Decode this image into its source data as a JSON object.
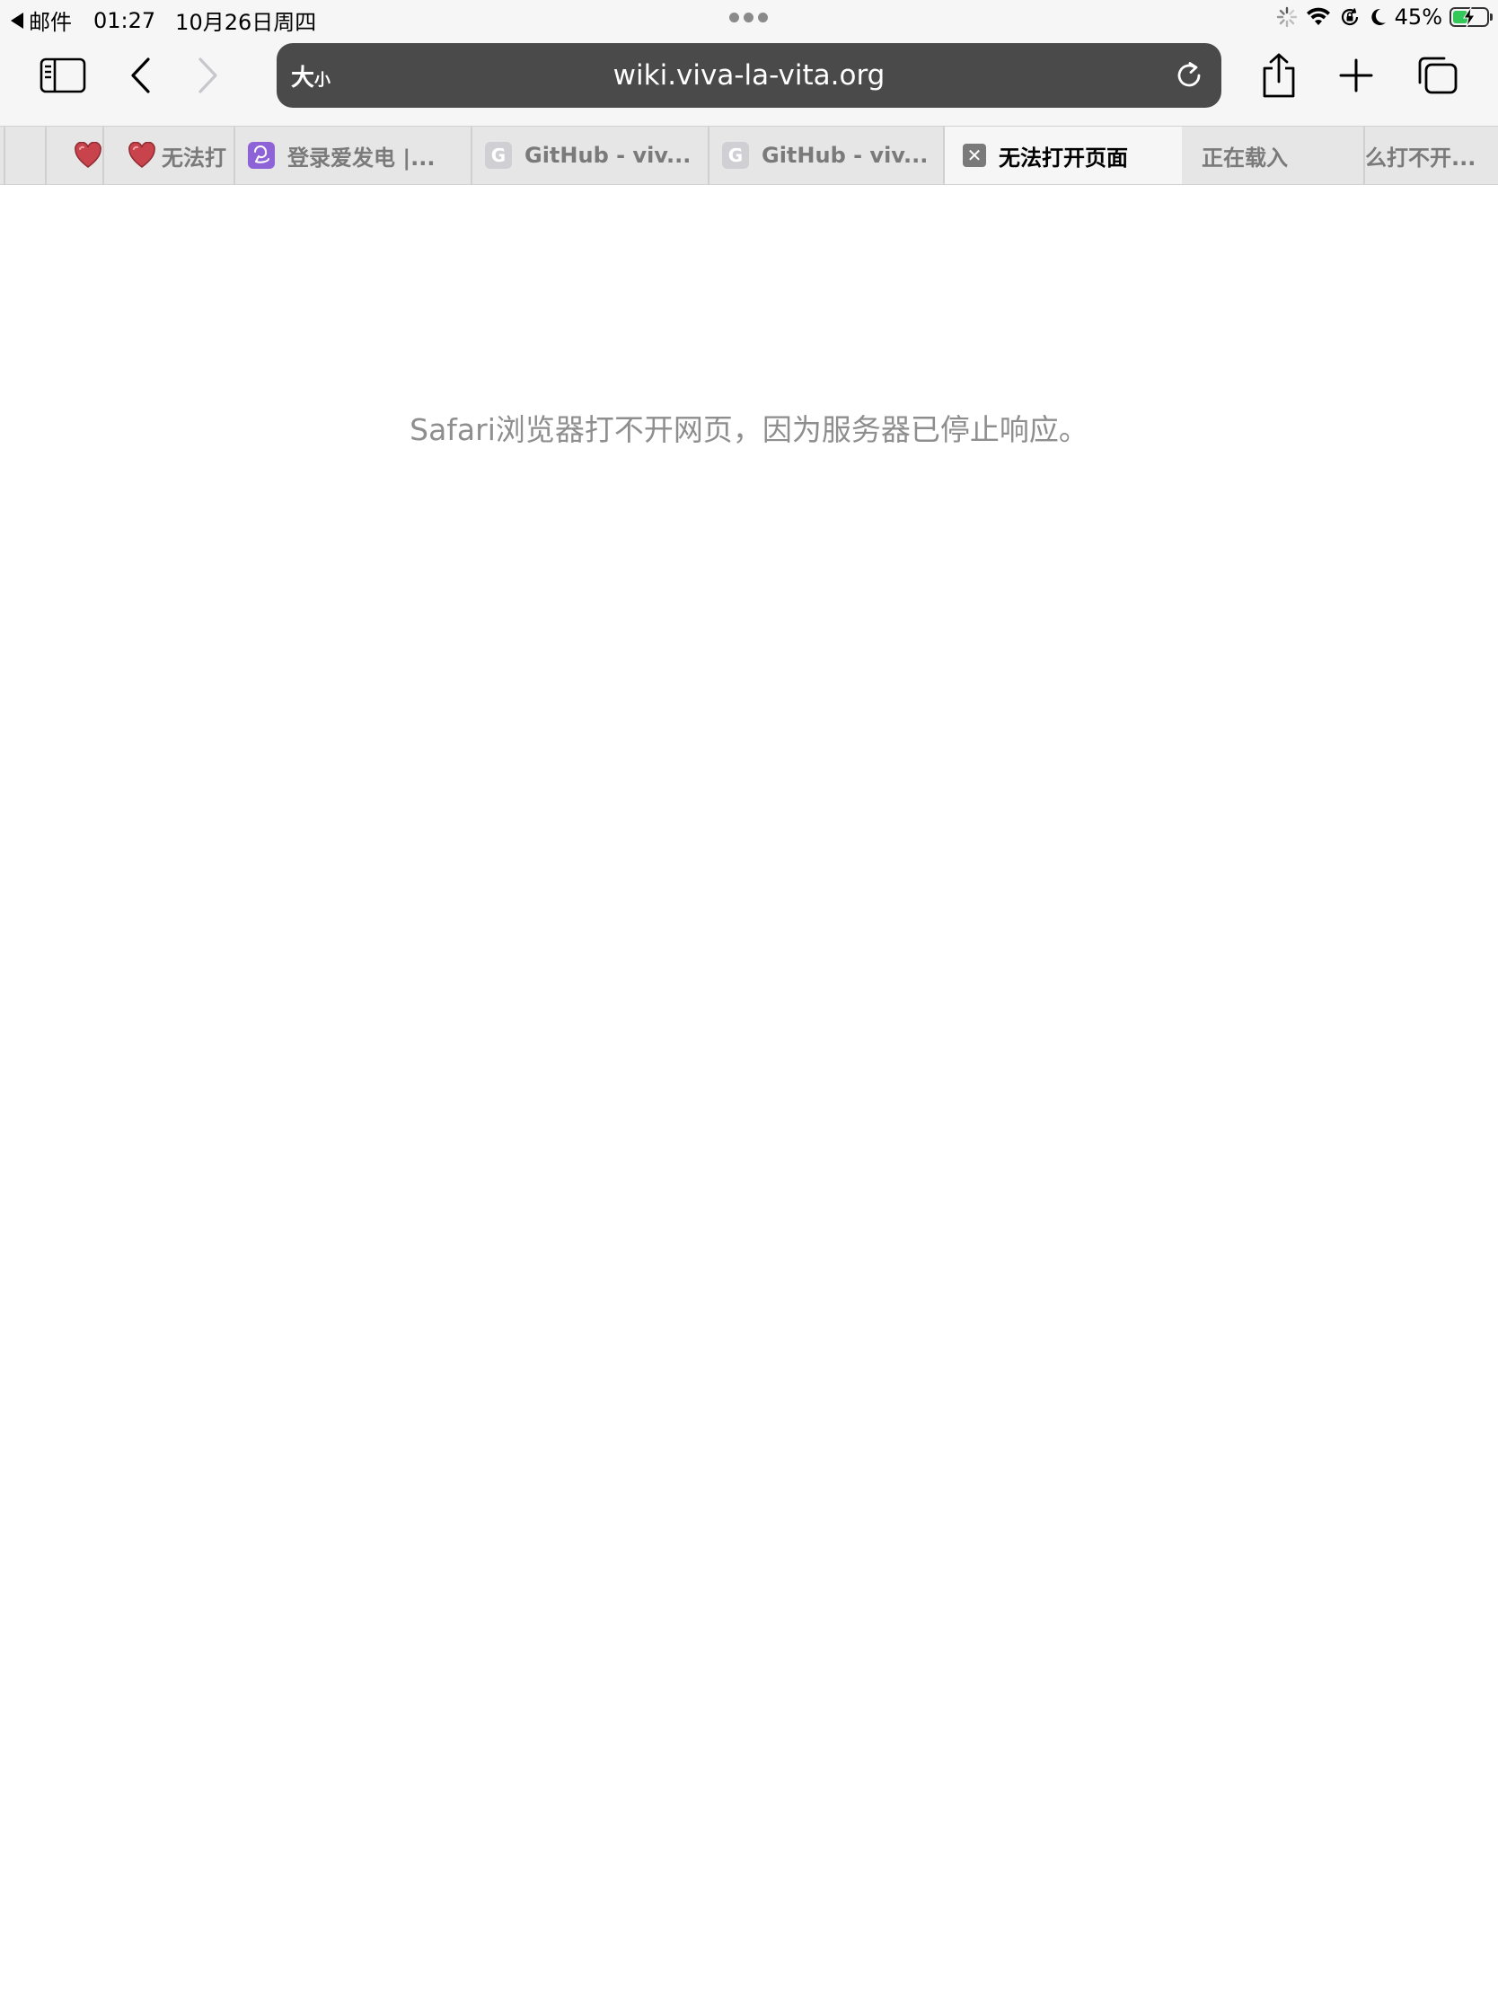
{
  "status_bar": {
    "back_app": "邮件",
    "time": "01:27",
    "date": "10月26日周四",
    "battery_percent": "45%",
    "battery_level": 0.45
  },
  "toolbar": {
    "aa_big": "大",
    "aa_small": "小",
    "url": "wiki.viva-la-vita.org"
  },
  "tabs": [
    {
      "title": ""
    },
    {
      "title": "无法打"
    },
    {
      "title": "登录爱发电 |..."
    },
    {
      "title": "GitHub - viv..."
    },
    {
      "title": "GitHub - viv..."
    },
    {
      "title": "无法打开页面"
    },
    {
      "title": "正在载入"
    },
    {
      "title": "么打不开..."
    }
  ],
  "tab_icons": {
    "g_letter": "G",
    "x_letter": "✕"
  },
  "page": {
    "error_message": "Safari浏览器打不开网页，因为服务器已停止响应。"
  },
  "colors": {
    "chrome_bg": "#f6f6f6",
    "address_bar_bg": "#4a4a4a",
    "error_text": "#8e8e8e",
    "battery_fill": "#34c759",
    "heart": "#c8434b"
  }
}
